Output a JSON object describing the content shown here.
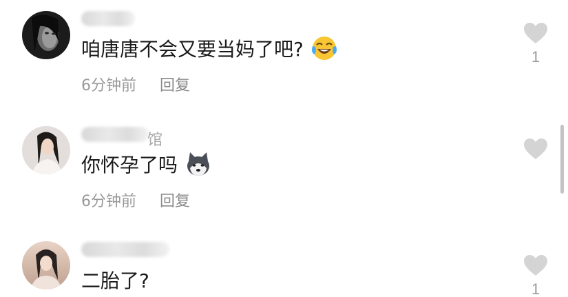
{
  "comments": [
    {
      "username_suffix": "",
      "text": "咱唐唐不会又要当妈了吧?",
      "emoji": "laughing-tears-emoji",
      "time": "6分钟前",
      "reply_label": "回复",
      "likes": "1"
    },
    {
      "username_suffix": "馆",
      "text": "你怀孕了吗",
      "emoji": "husky-dog-emoji",
      "time": "6分钟前",
      "reply_label": "回复",
      "likes": ""
    },
    {
      "username_suffix": "",
      "text": "二胎了?",
      "emoji": "",
      "time": "",
      "reply_label": "",
      "likes": "1"
    }
  ],
  "icons": {
    "like": "heart-icon"
  },
  "colors": {
    "text": "#1a1a1a",
    "meta": "#9a9a9a",
    "heart": "#d4d4d4"
  }
}
